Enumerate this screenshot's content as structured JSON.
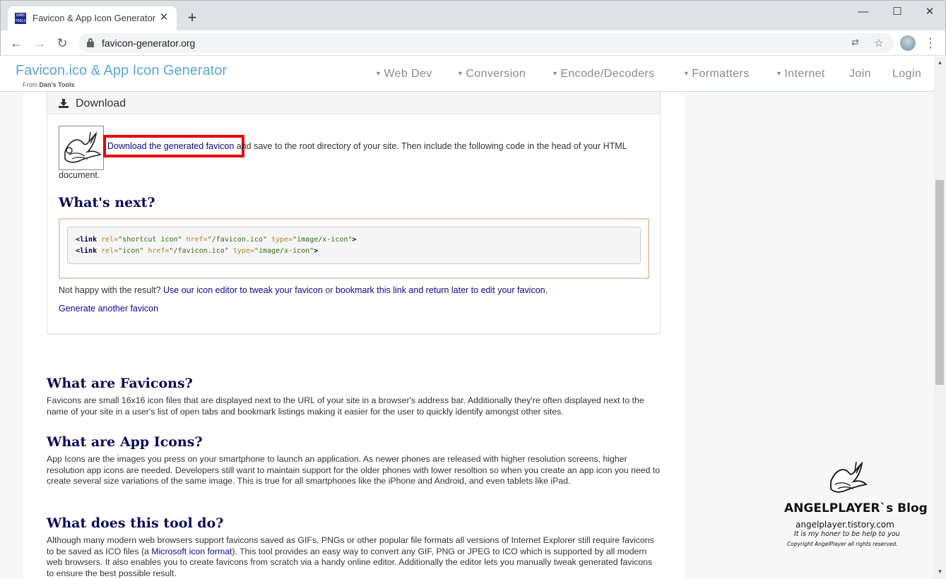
{
  "browser": {
    "tab_title": "Favicon & App Icon Generator",
    "tab_favicon_text": "DANS TOOLS",
    "url": "favicon-generator.org",
    "icons": [
      "back-icon",
      "forward-icon",
      "reload-icon",
      "lock-icon",
      "translate-icon",
      "star-icon",
      "avatar",
      "menu-icon",
      "minimize-icon",
      "maximize-icon",
      "close-icon"
    ]
  },
  "site": {
    "title": "Favicon.ico & App Icon Generator",
    "subtitle_prefix": "From",
    "subtitle_brand": "Dan's Tools",
    "nav": [
      {
        "label": "Web Dev",
        "dropdown": true
      },
      {
        "label": "Conversion",
        "dropdown": true
      },
      {
        "label": "Encode/Decoders",
        "dropdown": true
      },
      {
        "label": "Formatters",
        "dropdown": true
      },
      {
        "label": "Internet",
        "dropdown": true
      },
      {
        "label": "Join",
        "dropdown": false
      },
      {
        "label": "Login",
        "dropdown": false
      }
    ]
  },
  "download_panel": {
    "title": "Download",
    "download_link": "Download the generated favicon",
    "download_text": " and save to the root directory of your site. Then include the following code in the head of your HTML document.",
    "whats_next": "What's next?",
    "code_lines": [
      {
        "tag": "<link",
        "rel_attr": "rel=",
        "rel_val": "\"shortcut icon\"",
        "href_attr": "href=",
        "href_val": "\"/favicon.ico\"",
        "type_attr": "type=",
        "type_val": "\"image/x-icon\"",
        "close": ">"
      },
      {
        "tag": "<link",
        "rel_attr": "rel=",
        "rel_val": "\"icon\"",
        "href_attr": "href=",
        "href_val": "\"/favicon.ico\"",
        "type_attr": "type=",
        "type_val": "\"image/x-icon\"",
        "close": ">"
      }
    ],
    "not_happy_prefix": "Not happy with the result?",
    "editor_link": "Use our icon editor to tweak your favicon",
    "or_text": "or",
    "bookmark_link": "bookmark this link and return later to edit your favicon",
    "period": ".",
    "generate_another": "Generate another favicon"
  },
  "sections": [
    {
      "heading": "What are Favicons?",
      "body": "Favicons are small 16x16 icon files that are displayed next to the URL of your site in a browser's address bar. Additionally they're often displayed next to the name of your site in a user's list of open tabs and bookmark listings making it easier for the user to quickly identify amongst other sites."
    },
    {
      "heading": "What are App Icons?",
      "body": "App Icons are the images you press on your smartphone to launch an application. As newer phones are released with higher resolution screens, higher resolution app icons are needed. Developers still want to maintain support for the older phones with lower resoltion so when you create an app icon you need to create several size variations of the same image. This is true for all smartphones like the iPhone and Android, and even tablets like iPad."
    },
    {
      "heading": "What does this tool do?",
      "body_before": "Although many modern web browsers support favicons saved as GIFs, PNGs or other popular file formats all versions of Internet Explorer still require favicons to be saved as ICO files (a ",
      "body_link": "Microsoft icon format",
      "body_after": "). This tool provides an easy way to convert any GIF, PNG or JPEG to ICO which is supported by all modern web browsers. It also enables you to create favicons from scratch via a handy online editor. Additionally the editor lets you manually tweak generated favicons to ensure the best possible result."
    }
  ],
  "watermark": {
    "title": "ANGELPLAYER`s Blog",
    "url": "angelplayer.tistory.com",
    "tagline": "It is my honer to be help to you",
    "copyright": "Copyright AngelPlayer all rights reserved."
  },
  "colors": {
    "site_title": "#5aa6d6",
    "heading": "#0b0b57",
    "link": "#0a0a8a",
    "highlight_box": "#e8000b"
  }
}
